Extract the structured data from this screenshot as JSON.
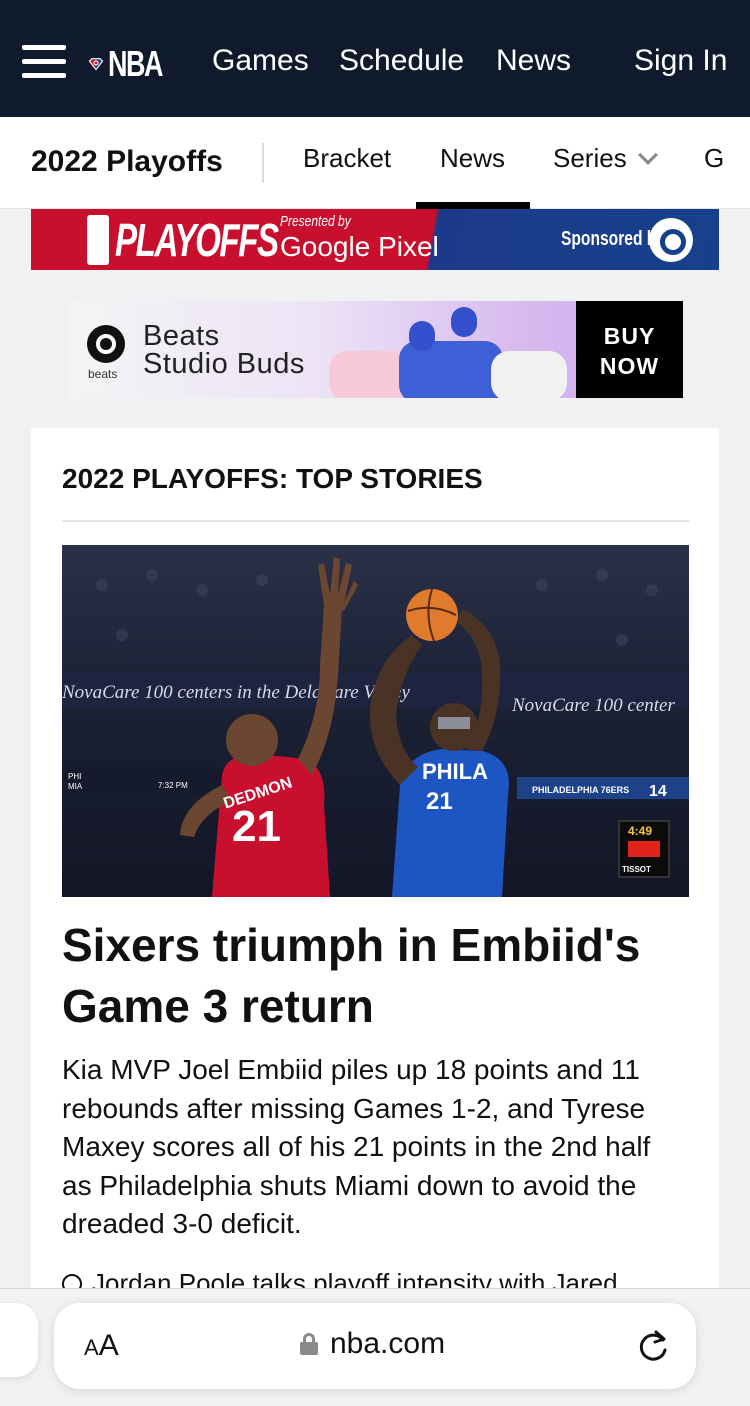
{
  "topnav": {
    "logo_text": "NBA",
    "links": [
      "Games",
      "Schedule",
      "News"
    ],
    "sign_in": "Sign In"
  },
  "subnav": {
    "title": "2022 Playoffs",
    "tabs": [
      "Bracket",
      "News",
      "Series",
      "G"
    ],
    "active_tab": "News"
  },
  "playoffs_banner": {
    "title": "PLAYOFFS",
    "presented_by": "Presented by",
    "presenter": "Google Pixel",
    "sponsored_by": "Sponsored by"
  },
  "beats_ad": {
    "brand_small": "beats",
    "product_line1": "Beats",
    "product_line2": "Studio Buds",
    "cta_line1": "BUY",
    "cta_line2": "NOW"
  },
  "card": {
    "heading": "2022 PLAYOFFS: TOP STORIES",
    "hero": {
      "arena_text_left": "NovaCare 100 centers in the Delaware Valley",
      "arena_text_right": "NovaCare 100 center",
      "scoreboard_label": "PHILADELPHIA 76ERS",
      "score_teams": [
        "PHI",
        "MIA"
      ],
      "time": "7:32 PM",
      "shot_clock": "4:49",
      "shot_clock_brand": "TISSOT",
      "number_right": "14",
      "player_left_name": "DEDMON",
      "player_left_number": "21",
      "player_right_team": "PHILA",
      "player_right_number": "21"
    },
    "headline": "Sixers triumph in Embiid's Game 3 return",
    "summary": "Kia MVP Joel Embiid piles up 18 points and 11 rebounds after missing Games 1-2, and Tyrese Maxey scores all of his 21 points in the 2nd half as Philadelphia shuts Miami down to avoid the dreaded 3-0 deficit.",
    "related": "Jordan Poole talks playoff intensity with Jared"
  },
  "browser": {
    "text_size_small": "A",
    "text_size_large": "A",
    "url": "nba.com"
  },
  "colors": {
    "nav_bg": "#0f1b2d",
    "playoffs_red": "#c8102e",
    "playoffs_blue": "#17408b"
  },
  "icons": [
    "hamburger-icon",
    "nba-logo-icon",
    "chevron-down-icon",
    "beats-logo-icon",
    "play-circle-icon",
    "lock-icon",
    "reload-icon"
  ]
}
